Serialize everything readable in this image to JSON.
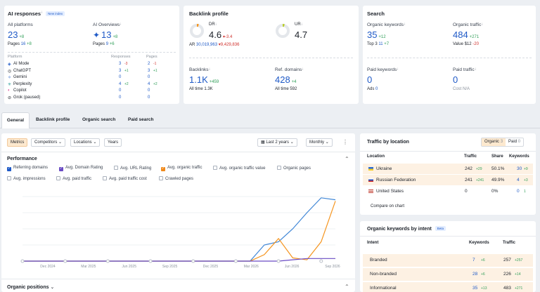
{
  "ai": {
    "title": "AI responses",
    "tag": "New index",
    "all_platforms_label": "All platforms",
    "all_platforms_value": "23",
    "all_platforms_delta": "+8",
    "pages_label": "Pages",
    "pages_value": "16",
    "pages_delta": "+8",
    "overviews_label": "AI Overviews",
    "overviews_value": "13",
    "overviews_delta": "+8",
    "ov_pages_label": "Pages",
    "ov_pages_value": "9",
    "ov_pages_delta": "+6",
    "col_platform": "Platform",
    "col_responses": "Responses",
    "col_pages": "Pages",
    "rows": [
      {
        "name": "AI Mode",
        "resp": "3",
        "resp_d": "-3",
        "pages": "2",
        "pages_d": "-1"
      },
      {
        "name": "ChatGPT",
        "resp": "3",
        "resp_d": "+1",
        "pages": "3",
        "pages_d": "+1"
      },
      {
        "name": "Gemini",
        "resp": "0",
        "resp_d": "",
        "pages": "0",
        "pages_d": ""
      },
      {
        "name": "Perplexity",
        "resp": "4",
        "resp_d": "+2",
        "pages": "4",
        "pages_d": "+2"
      },
      {
        "name": "Copilot",
        "resp": "0",
        "resp_d": "",
        "pages": "0",
        "pages_d": ""
      },
      {
        "name": "Grok (paused)",
        "resp": "0",
        "resp_d": "",
        "pages": "0",
        "pages_d": ""
      }
    ]
  },
  "backlinks": {
    "title": "Backlink profile",
    "dr_label": "DR",
    "dr_value": "4.6",
    "dr_delta": "-3.4",
    "ur_label": "UR",
    "ur_value": "4.7",
    "ar_label": "AR",
    "ar_value": "30,019,963",
    "ar_delta": "9,429,836",
    "bl_label": "Backlinks",
    "bl_value": "1.1K",
    "bl_delta": "+459",
    "bl_all": "All time 1.3K",
    "rd_label": "Ref. domains",
    "rd_value": "428",
    "rd_delta": "+4",
    "rd_all": "All time 592"
  },
  "search": {
    "title": "Search",
    "ok_label": "Organic keywords",
    "ok_value": "35",
    "ok_delta": "+12",
    "top3_label": "Top 3",
    "top3_value": "11",
    "top3_delta": "+7",
    "ot_label": "Organic traffic",
    "ot_value": "484",
    "ot_delta": "+271",
    "val_label": "Value",
    "val_value": "$12",
    "val_delta": "-20",
    "pk_label": "Paid keywords",
    "pk_value": "0",
    "ads_label": "Ads",
    "ads_value": "0",
    "pt_label": "Paid traffic",
    "pt_value": "0",
    "cost_label": "Cost",
    "cost_value": "N/A"
  },
  "tabs": [
    "General",
    "Backlink profile",
    "Organic search",
    "Paid search"
  ],
  "toolbar": {
    "metrics": "Metrics",
    "competitors": "Competitors",
    "locations": "Locations",
    "years": "Years",
    "range": "Last 2 years",
    "interval": "Monthly",
    "more": "⋮"
  },
  "performance": {
    "title": "Performance",
    "checks": [
      {
        "label": "Referring domains",
        "on": true,
        "color": "#1f5ac7"
      },
      {
        "label": "Avg. Domain Rating",
        "on": true,
        "color": "#6a4bc4"
      },
      {
        "label": "Avg. URL Rating",
        "on": false
      },
      {
        "label": "Avg. organic traffic",
        "on": true,
        "color": "#f08a1c"
      },
      {
        "label": "Avg. organic traffic value",
        "on": false
      },
      {
        "label": "Organic pages",
        "on": false
      },
      {
        "label": "Avg. impressions",
        "on": false
      },
      {
        "label": "Avg. paid traffic",
        "on": false
      },
      {
        "label": "Avg. paid traffic cost",
        "on": false
      },
      {
        "label": "Crawled pages",
        "on": false
      }
    ]
  },
  "chart_data": {
    "type": "line",
    "x": [
      "Dec 2024",
      "Mar 2025",
      "Jun 2025",
      "Sep 2025",
      "Dec 2025",
      "Mar 2026",
      "Jun 2026",
      "Sep 2026"
    ],
    "series": [
      {
        "name": "Referring domains",
        "color": "#3f86d6",
        "values": [
          0,
          0,
          0,
          0,
          0,
          0,
          0,
          0,
          0,
          0,
          0,
          0,
          0,
          0,
          0,
          0,
          0,
          0.25,
          0.3,
          0.5,
          0.75,
          0.98,
          0.95
        ]
      },
      {
        "name": "Avg. organic traffic",
        "color": "#f5951f",
        "values": [
          0,
          0,
          0,
          0,
          0,
          0,
          0,
          0,
          0,
          0,
          0,
          0,
          0,
          0,
          0,
          0,
          0,
          0.1,
          0.35,
          0.05,
          0.02,
          0.3,
          0.93
        ]
      },
      {
        "name": "Avg. Domain Rating",
        "color": "#6a4bc4",
        "values": [
          0,
          0,
          0,
          0,
          0,
          0,
          0,
          0,
          0,
          0,
          0,
          0,
          0,
          0,
          0,
          0,
          0,
          0,
          0,
          0.02,
          0.04,
          0.04,
          0.04
        ]
      }
    ]
  },
  "organic_positions": {
    "title": "Organic positions"
  },
  "traffic_by_location": {
    "title": "Traffic by location",
    "seg_organic": "Organic",
    "seg_organic_count": "3",
    "seg_paid": "Paid",
    "seg_paid_count": "0",
    "col_location": "Location",
    "col_traffic": "Traffic",
    "col_share": "Share",
    "col_keywords": "Keywords",
    "rows": [
      {
        "country": "Ukraine",
        "traffic": "242",
        "traffic_d": "+29",
        "share": "50.1%",
        "kw": "30",
        "kw_d": "+9"
      },
      {
        "country": "Russian Federation",
        "traffic": "241",
        "traffic_d": "+241",
        "share": "49.9%",
        "kw": "4",
        "kw_d": "+3"
      },
      {
        "country": "United States",
        "traffic": "0",
        "traffic_d": "",
        "share": "0%",
        "kw": "0",
        "kw_d": "1"
      }
    ],
    "compare": "Compare on chart"
  },
  "keywords_by_intent": {
    "title": "Organic keywords by intent",
    "tag": "Beta",
    "col_intent": "Intent",
    "col_keywords": "Keywords",
    "col_traffic": "Traffic",
    "rows": [
      {
        "intent": "Branded",
        "kw": "7",
        "kw_d": "+6",
        "traffic": "257",
        "traffic_d": "+257"
      },
      {
        "intent": "Non-branded",
        "kw": "28",
        "kw_d": "+6",
        "traffic": "226",
        "traffic_d": "+14"
      },
      {
        "intent": "Informational",
        "kw": "35",
        "kw_d": "+13",
        "traffic": "483",
        "traffic_d": "+271"
      }
    ]
  }
}
